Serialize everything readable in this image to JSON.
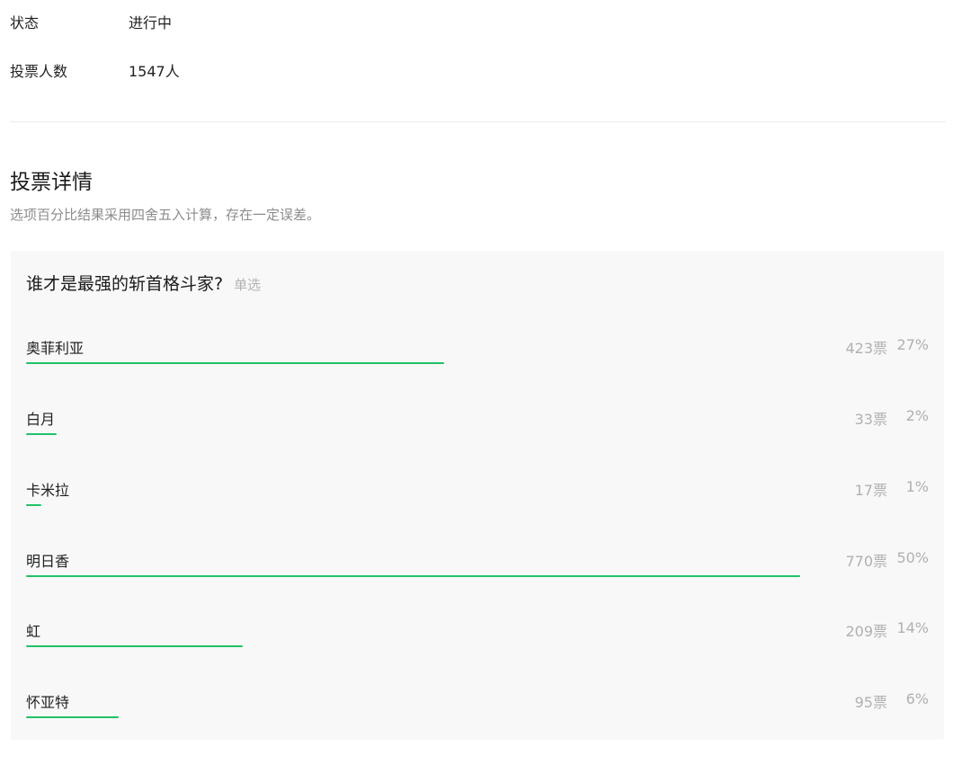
{
  "summary": {
    "status_label": "状态",
    "status_value": "进行中",
    "voters_label": "投票人数",
    "voters_value": "1547人"
  },
  "details": {
    "title": "投票详情",
    "note": "选项百分比结果采用四舍五入计算，存在一定误差。"
  },
  "poll": {
    "question": "谁才是最强的斩首格斗家?",
    "type": "单选",
    "bar_color": "#22c168",
    "options": [
      {
        "label": "奥菲利亚",
        "votes": "423票",
        "percent": "27%",
        "share": 0.27
      },
      {
        "label": "白月",
        "votes": "33票",
        "percent": "2%",
        "share": 0.02
      },
      {
        "label": "卡米拉",
        "votes": "17票",
        "percent": "1%",
        "share": 0.01
      },
      {
        "label": "明日香",
        "votes": "770票",
        "percent": "50%",
        "share": 0.5
      },
      {
        "label": "虹",
        "votes": "209票",
        "percent": "14%",
        "share": 0.14
      },
      {
        "label": "怀亚特",
        "votes": "95票",
        "percent": "6%",
        "share": 0.06
      }
    ]
  }
}
